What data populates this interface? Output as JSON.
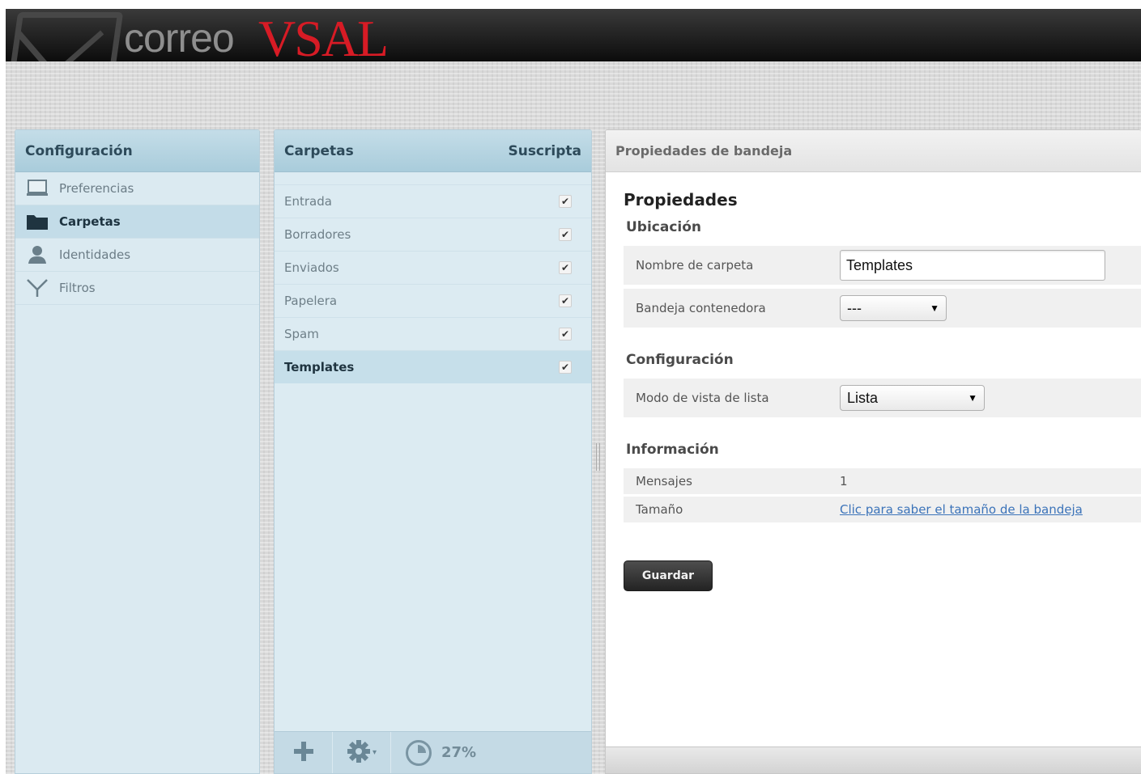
{
  "header": {
    "logo_word": "correo",
    "logo_brand": "VSAL"
  },
  "settings": {
    "title": "Configuración",
    "items": [
      {
        "label": "Preferencias",
        "icon": "monitor-icon"
      },
      {
        "label": "Carpetas",
        "icon": "folder-icon",
        "selected": true
      },
      {
        "label": "Identidades",
        "icon": "user-icon"
      },
      {
        "label": "Filtros",
        "icon": "filter-icon"
      }
    ]
  },
  "folders": {
    "title": "Carpetas",
    "subscribed_label": "Suscripta",
    "items": [
      {
        "label": "Entrada",
        "check": "✔"
      },
      {
        "label": "Borradores",
        "check": "✔"
      },
      {
        "label": "Enviados",
        "check": "✔"
      },
      {
        "label": "Papelera",
        "check": "✔"
      },
      {
        "label": "Spam",
        "check": "✔"
      },
      {
        "label": "Templates",
        "check": "✔",
        "selected": true
      }
    ],
    "footer": {
      "add": "+",
      "gear_menu": "▾",
      "quota": "27%"
    }
  },
  "properties": {
    "panel_title": "Propiedades de bandeja",
    "heading": "Propiedades",
    "location": {
      "title": "Ubicación",
      "folder_name_label": "Nombre de carpeta",
      "folder_name_value": "Templates",
      "parent_label": "Bandeja contenedora",
      "parent_value": "---"
    },
    "config": {
      "title": "Configuración",
      "view_mode_label": "Modo de vista de lista",
      "view_mode_value": "Lista"
    },
    "info": {
      "title": "Información",
      "messages_label": "Mensajes",
      "messages_value": "1",
      "size_label": "Tamaño",
      "size_link": "Clic para saber el tamaño de la bandeja"
    },
    "save_label": "Guardar"
  },
  "colors": {
    "brand_red": "#d71b25",
    "panel_blue": "#c4dde8",
    "link": "#3b73b9"
  }
}
